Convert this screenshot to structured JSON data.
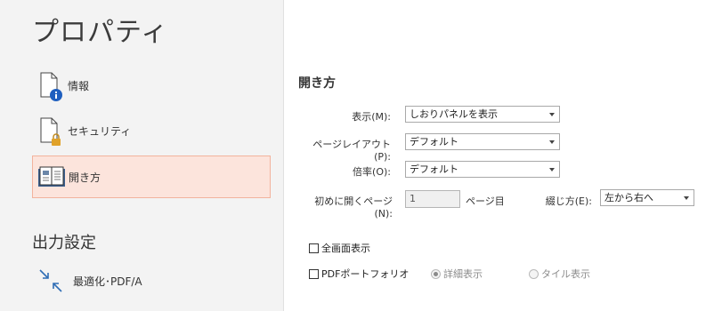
{
  "title": "プロパティ",
  "nav": {
    "items": [
      {
        "label": "情報",
        "icon": "document-info-icon"
      },
      {
        "label": "セキュリティ",
        "icon": "document-lock-icon"
      },
      {
        "label": "開き方",
        "icon": "open-book-icon"
      }
    ],
    "selected": "開き方"
  },
  "export": {
    "heading": "出力設定",
    "item_label": "最適化･PDF/A",
    "item_icon": "compress-arrows-icon"
  },
  "opening": {
    "heading": "開き方",
    "display_label": "表示(M):",
    "display_value": "しおりパネルを表示",
    "layout_label": "ページレイアウト(P):",
    "layout_value": "デフォルト",
    "zoom_label": "倍率(O):",
    "zoom_value": "デフォルト",
    "open_page_label": "初めに開くページ(N):",
    "open_page_value": "1",
    "page_suffix": "ページ目",
    "binding_label": "綴じ方(E):",
    "binding_value": "左から右へ",
    "fullscreen_label": "全画面表示",
    "portfolio_label": "PDFポートフォリオ",
    "detail_view_label": "詳細表示",
    "tile_view_label": "タイル表示"
  },
  "colors": {
    "selected_bg": "#fce4dc",
    "selected_border": "#f2b39d",
    "info_blue": "#1f5fbf",
    "lock_gold": "#e0a22a"
  }
}
